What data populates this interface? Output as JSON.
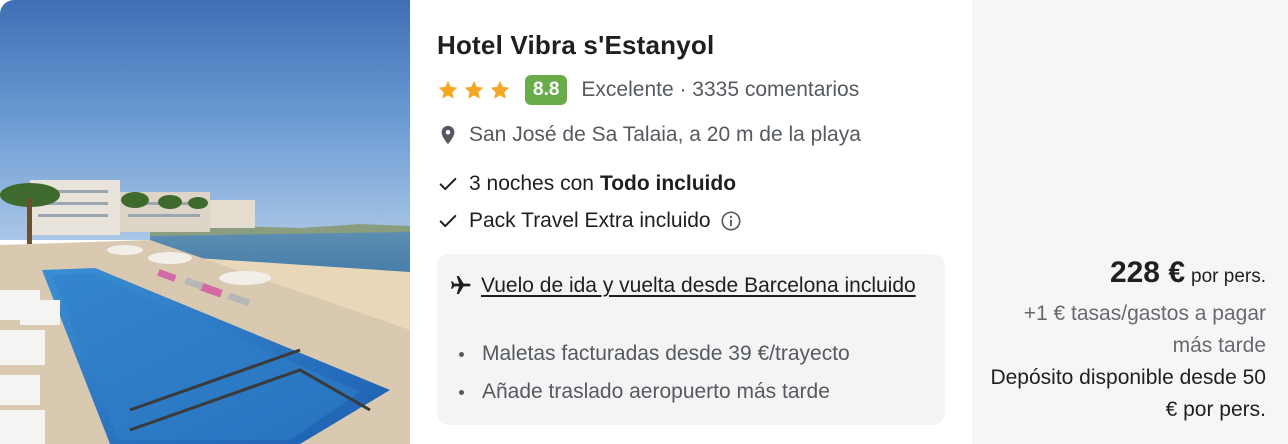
{
  "hotel": {
    "name": "Hotel Vibra s'Estanyol",
    "stars": 3,
    "score": "8.8",
    "rating_text": "Excelente · 3335 comentarios",
    "location": "San José de Sa Talaia, a 20 m de la playa",
    "photo_icon": "hotel-pool-photo"
  },
  "features": {
    "nights_prefix": "3 noches con",
    "nights_bold": "Todo incluido",
    "pack": "Pack Travel Extra incluido"
  },
  "flight": {
    "title": "Vuelo de ida y vuelta desde Barcelona incluido",
    "bullets": [
      "Maletas facturadas desde 39 €/trayecto",
      "Añade traslado aeropuerto más tarde"
    ]
  },
  "price": {
    "amount": "228 €",
    "per": "por pers.",
    "fees": "+1 € tasas/gastos a pagar más tarde",
    "deposit": "Depósito disponible desde 50 € por pers."
  },
  "colors": {
    "star": "#f5a623",
    "score_badge": "#6aac4a",
    "price_bg": "#f6f6f7",
    "flight_bg": "#f4f4f5"
  }
}
